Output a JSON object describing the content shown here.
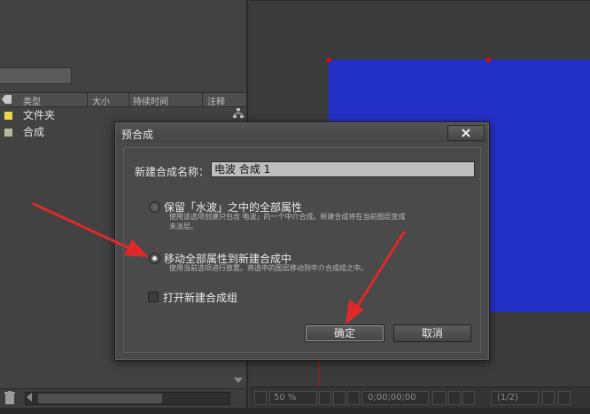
{
  "project_panel": {
    "columns": [
      "类型",
      "大小",
      "持续时间",
      "注释"
    ],
    "items": [
      {
        "label": "文件夹",
        "color": "#e8d84a"
      },
      {
        "label": "合成",
        "color": "#b8b89a"
      }
    ]
  },
  "viewer": {
    "zoom": "50 %",
    "timecode": "0;00;00;00",
    "resolution": "(1/2)",
    "layer_color": "#2330c8"
  },
  "dialog": {
    "title": "预合成",
    "name_label": "新建合成名称：",
    "name_value": "电波 合成 1",
    "option1": {
      "label": "保留「水波」之中的全部属性",
      "desc": "使用该选项创建只包含 电波」的一个中介合成。新建合成将在当前图层变成未派层。",
      "selected": false
    },
    "option2": {
      "label": "移动全部属性到新建合成中",
      "desc": "使用当前选项进行放置。将选中的图层移动到中介合成组之中。",
      "selected": true
    },
    "checkbox_label": "打开新建合成组",
    "ok_label": "确定",
    "cancel_label": "取消"
  },
  "annotation_color": "#e02828"
}
